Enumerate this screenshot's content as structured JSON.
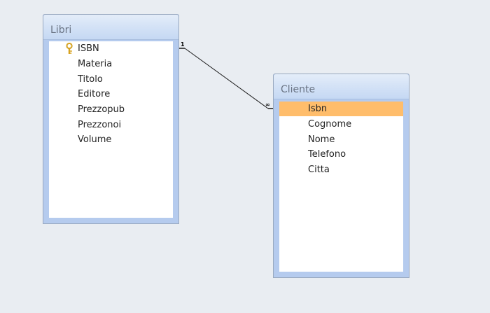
{
  "tables": [
    {
      "title": "Libri",
      "fields": [
        {
          "name": "ISBN",
          "primary_key": true
        },
        {
          "name": "Materia"
        },
        {
          "name": "Titolo"
        },
        {
          "name": "Editore"
        },
        {
          "name": "Prezzopub"
        },
        {
          "name": "Prezzonoi"
        },
        {
          "name": "Volume"
        }
      ]
    },
    {
      "title": "Cliente",
      "fields": [
        {
          "name": "Isbn",
          "selected": true
        },
        {
          "name": "Cognome"
        },
        {
          "name": "Nome"
        },
        {
          "name": "Telefono"
        },
        {
          "name": "Citta"
        }
      ]
    }
  ],
  "relationship": {
    "from_cardinality": "1",
    "to_cardinality": "∞"
  },
  "colors": {
    "background": "#e9edf2",
    "selected_row": "#ffbd6b",
    "key_icon": "#d8a320"
  }
}
